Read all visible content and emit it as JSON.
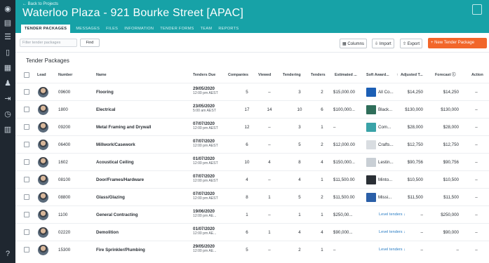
{
  "sidebar": {
    "icons": [
      "user-circle-icon",
      "building-icon",
      "list-icon",
      "clipboard-icon",
      "calendar-icon",
      "people-icon",
      "sign-in-icon",
      "clock-icon",
      "bar-chart-icon",
      "help-icon"
    ]
  },
  "header": {
    "back": "← Back to Projects",
    "title": "Waterloo Plaza - 921 Bourke Street [APAC]"
  },
  "tabs": [
    "TENDER PACKAGES",
    "MESSAGES",
    "FILES",
    "INFORMATION",
    "TENDER FORMS",
    "TEAM",
    "REPORTS"
  ],
  "toolbar": {
    "filter_placeholder": "Filter tender packages",
    "find": "Find",
    "columns": "Columns",
    "import": "Import",
    "export": "Export",
    "new": "+  New Tender Package"
  },
  "section_title": "Tender Packages",
  "columns": {
    "lead": "Lead",
    "number": "Number",
    "name": "Name",
    "tenders_due": "Tenders Due",
    "companies": "Companies",
    "viewed": "Viewed",
    "tendering": "Tendering",
    "tenders": "Tenders",
    "estimated": "Estimated ...",
    "soft_award": "Soft Award...",
    "adjusted": "Adjusted T...",
    "forecast": "Forecast ⓘ",
    "action": "Action"
  },
  "rows": [
    {
      "number": "09600",
      "name": "Flooring",
      "due_date": "29/05/2020",
      "due_time": "12:00 pm AEST",
      "companies": "5",
      "viewed": "–",
      "tendering": "3",
      "tenders": "2",
      "estimated": "$15,000.00",
      "award": "All Co...",
      "adjusted": "$14,250",
      "forecast": "$14,250",
      "action": "–",
      "logo": "#1c5fb5"
    },
    {
      "number": "1800",
      "name": "Electrical",
      "due_date": "23/05/2020",
      "due_time": "5:00 am AEST",
      "companies": "17",
      "viewed": "14",
      "tendering": "10",
      "tenders": "6",
      "estimated": "$100,000...",
      "award": "Black...",
      "adjusted": "$130,000",
      "forecast": "$130,000",
      "action": "–",
      "logo": "#2f6e5a"
    },
    {
      "number": "09200",
      "name": "Metal Framing and Drywall",
      "due_date": "07/07/2020",
      "due_time": "12:00 pm AEST",
      "companies": "12",
      "viewed": "–",
      "tendering": "3",
      "tenders": "1",
      "estimated": "–",
      "award": "Com...",
      "adjusted": "$28,000",
      "forecast": "$28,000",
      "action": "–",
      "logo": "#3aa3a8"
    },
    {
      "number": "06400",
      "name": "Millwork/Casework",
      "due_date": "07/07/2020",
      "due_time": "12:00 pm AEST",
      "companies": "6",
      "viewed": "–",
      "tendering": "5",
      "tenders": "2",
      "estimated": "$12,000.00",
      "award": "Crafts...",
      "adjusted": "$12,750",
      "forecast": "$12,750",
      "action": "–",
      "logo": "#d9dde1"
    },
    {
      "number": "1602",
      "name": "Acoustical Ceiling",
      "due_date": "01/07/2020",
      "due_time": "12:00 pm AEST",
      "companies": "10",
      "viewed": "4",
      "tendering": "8",
      "tenders": "4",
      "estimated": "$150,000...",
      "award": "Lestin...",
      "adjusted": "$90,756",
      "forecast": "$90,756",
      "action": "–",
      "logo": "#c9cfd5"
    },
    {
      "number": "08100",
      "name": "Door/Frames/Hardware",
      "due_date": "07/07/2020",
      "due_time": "12:00 pm AEST",
      "companies": "4",
      "viewed": "–",
      "tendering": "4",
      "tenders": "1",
      "estimated": "$11,500.00",
      "award": "Minto...",
      "adjusted": "$10,500",
      "forecast": "$10,500",
      "action": "–",
      "logo": "#2a2f35"
    },
    {
      "number": "08800",
      "name": "Glass/Glazing",
      "due_date": "07/07/2020",
      "due_time": "12:00 pm AEST",
      "companies": "8",
      "viewed": "1",
      "tendering": "5",
      "tenders": "2",
      "estimated": "$11,500.00",
      "award": "Missi...",
      "adjusted": "$11,500",
      "forecast": "$11,500",
      "action": "–",
      "logo": "#2b5fa8"
    },
    {
      "number": "1100",
      "name": "General Contracting",
      "due_date": "19/06/2020",
      "due_time": "12:00 pm AE...",
      "companies": "1",
      "viewed": "–",
      "tendering": "1",
      "tenders": "1",
      "estimated": "$250,00...",
      "award": "Level tenders ↓",
      "adjusted": "–",
      "forecast": "$250,000",
      "action": "–",
      "logo": ""
    },
    {
      "number": "02220",
      "name": "Demolition",
      "due_date": "01/07/2020",
      "due_time": "12:00 pm AE...",
      "companies": "6",
      "viewed": "1",
      "tendering": "4",
      "tenders": "4",
      "estimated": "$90,000...",
      "award": "Level tenders ↓",
      "adjusted": "–",
      "forecast": "$90,000",
      "action": "–",
      "logo": ""
    },
    {
      "number": "15300",
      "name": "Fire Sprinkler/Plumbing",
      "due_date": "29/05/2020",
      "due_time": "12:00 pm AE...",
      "companies": "5",
      "viewed": "–",
      "tendering": "2",
      "tenders": "1",
      "estimated": "–",
      "award": "Level tenders ↓",
      "adjusted": "–",
      "forecast": "–",
      "action": "–",
      "logo": ""
    }
  ]
}
